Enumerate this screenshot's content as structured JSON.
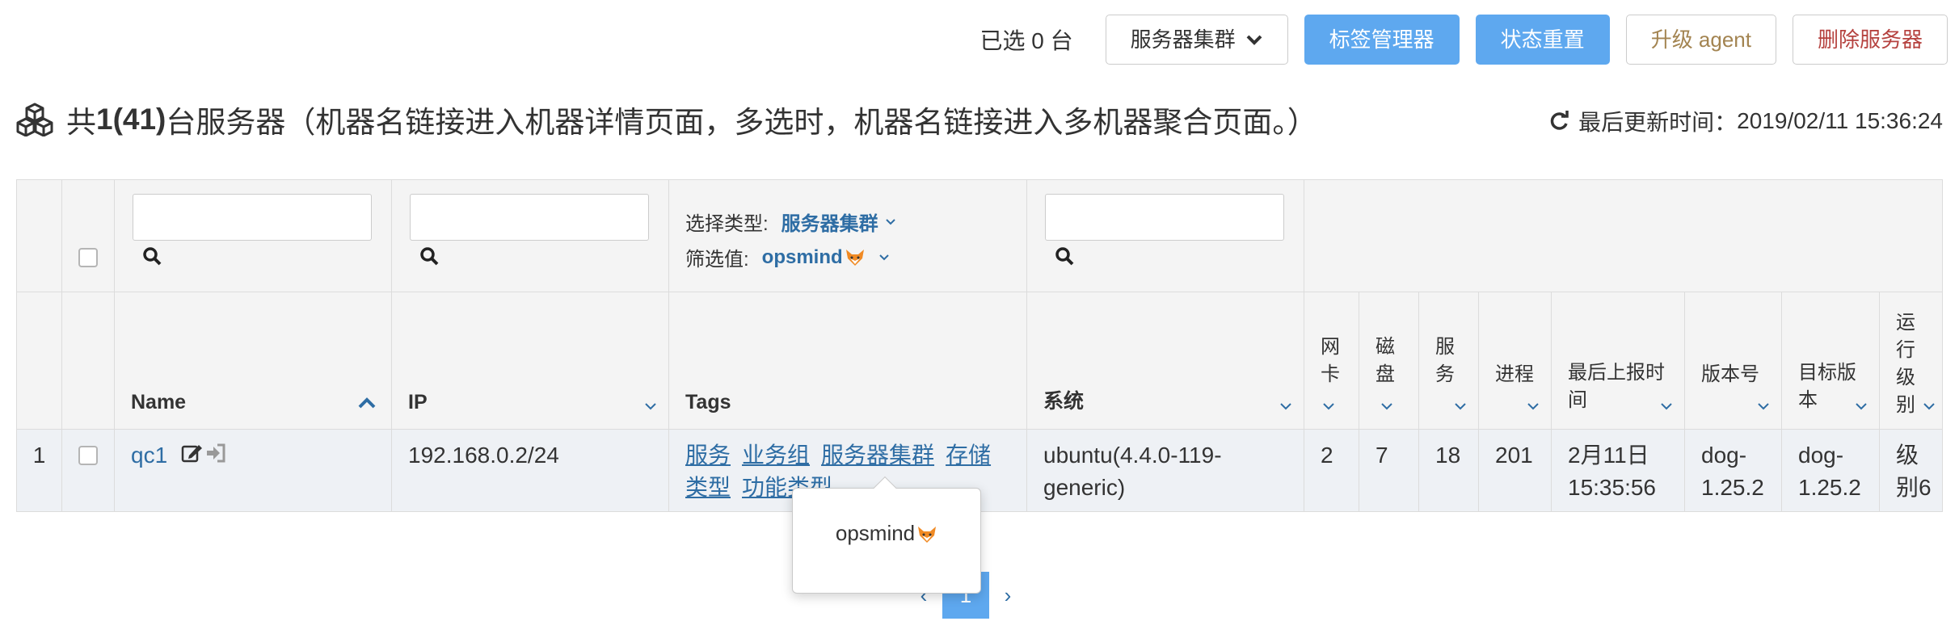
{
  "toolbar": {
    "selected_count": "已选 0 台",
    "cluster_dropdown": "服务器集群",
    "tag_manager": "标签管理器",
    "status_reset": "状态重置",
    "upgrade_agent": "升级 agent",
    "delete_server": "删除服务器"
  },
  "header": {
    "prefix": "共 ",
    "count": "1(41)",
    "suffix": " 台服务器（机器名链接进入机器详情页面，多选时，机器名链接进入多机器聚合页面。）",
    "updated_label": "最后更新时间：",
    "updated_time": "2019/02/11 15:36:24"
  },
  "filters": {
    "type_label": "选择类型:",
    "type_value": "服务器集群",
    "filter_label": "筛选值:",
    "filter_value": "opsmind"
  },
  "columns": {
    "name": "Name",
    "ip": "IP",
    "tags": "Tags",
    "os": "系统",
    "nic": [
      "网",
      "卡"
    ],
    "disk": [
      "磁",
      "盘"
    ],
    "service": [
      "服",
      "务"
    ],
    "process": "进程",
    "last_report": [
      "最后上报时",
      "间"
    ],
    "version": "版本号",
    "target_version": [
      "目标版",
      "本"
    ],
    "run_level": [
      "运",
      "行",
      "级",
      "别"
    ]
  },
  "rows": [
    {
      "index": "1",
      "name": "qc1",
      "ip": "192.168.0.2/24",
      "tags": [
        "服务",
        "业务组",
        "服务器集群",
        "存储",
        "类型",
        "功能类型"
      ],
      "os": [
        "ubuntu(4.4.0-119-",
        "generic)"
      ],
      "nic": "2",
      "disk": "7",
      "service": "18",
      "process": "201",
      "last_report": [
        "2月11日",
        "15:35:56"
      ],
      "version": [
        "dog-",
        "1.25.2"
      ],
      "target_version": [
        "dog-",
        "1.25.2"
      ],
      "run_level": [
        "级",
        "别6"
      ]
    }
  ],
  "popover": {
    "text": "opsmind"
  },
  "pagination": {
    "prev": "‹",
    "current": "1",
    "next": "›"
  },
  "colors": {
    "primary": "#5ea8ef",
    "link": "#2e6da4",
    "warn": "#a38451",
    "danger": "#b5423f"
  }
}
